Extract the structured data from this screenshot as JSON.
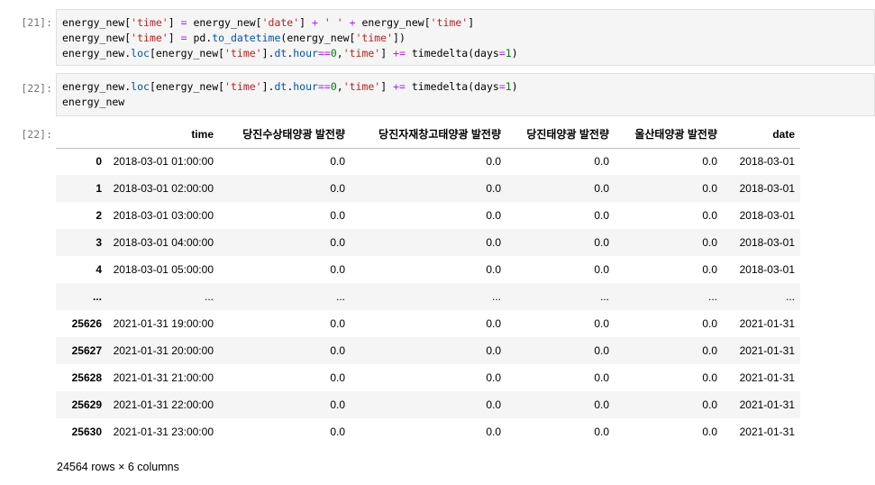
{
  "cells": [
    {
      "prompt": "[21]:",
      "lines": [
        [
          [
            "var",
            "energy_new["
          ],
          [
            "str",
            "'time'"
          ],
          [
            "var",
            "] "
          ],
          [
            "op",
            "="
          ],
          [
            "var",
            " energy_new["
          ],
          [
            "str",
            "'date'"
          ],
          [
            "var",
            "] "
          ],
          [
            "op",
            "+"
          ],
          [
            "var",
            " "
          ],
          [
            "str",
            "' '"
          ],
          [
            "var",
            " "
          ],
          [
            "op",
            "+"
          ],
          [
            "var",
            " energy_new["
          ],
          [
            "str",
            "'time'"
          ],
          [
            "var",
            "]"
          ]
        ],
        [
          [
            "var",
            "energy_new["
          ],
          [
            "str",
            "'time'"
          ],
          [
            "var",
            "] "
          ],
          [
            "op",
            "="
          ],
          [
            "var",
            " pd."
          ],
          [
            "attr",
            "to_datetime"
          ],
          [
            "var",
            "(energy_new["
          ],
          [
            "str",
            "'time'"
          ],
          [
            "var",
            "])"
          ]
        ],
        [
          [
            "var",
            "energy_new."
          ],
          [
            "attr",
            "loc"
          ],
          [
            "var",
            "[energy_new["
          ],
          [
            "str",
            "'time'"
          ],
          [
            "var",
            "]."
          ],
          [
            "attr",
            "dt"
          ],
          [
            "var",
            "."
          ],
          [
            "attr",
            "hour"
          ],
          [
            "op",
            "=="
          ],
          [
            "num",
            "0"
          ],
          [
            "var",
            ","
          ],
          [
            "str",
            "'time'"
          ],
          [
            "var",
            "] "
          ],
          [
            "op",
            "+="
          ],
          [
            "var",
            " timedelta(days"
          ],
          [
            "op",
            "="
          ],
          [
            "num",
            "1"
          ],
          [
            "var",
            ")"
          ]
        ]
      ]
    },
    {
      "prompt": "[22]:",
      "lines": [
        [
          [
            "var",
            "energy_new."
          ],
          [
            "attr",
            "loc"
          ],
          [
            "var",
            "[energy_new["
          ],
          [
            "str",
            "'time'"
          ],
          [
            "var",
            "]."
          ],
          [
            "attr",
            "dt"
          ],
          [
            "var",
            "."
          ],
          [
            "attr",
            "hour"
          ],
          [
            "op",
            "=="
          ],
          [
            "num",
            "0"
          ],
          [
            "var",
            ","
          ],
          [
            "str",
            "'time'"
          ],
          [
            "var",
            "] "
          ],
          [
            "op",
            "+="
          ],
          [
            "var",
            " timedelta(days"
          ],
          [
            "op",
            "="
          ],
          [
            "num",
            "1"
          ],
          [
            "var",
            ")"
          ]
        ],
        [
          [
            "var",
            "energy_new"
          ]
        ]
      ]
    }
  ],
  "output": {
    "prompt": "[22]:",
    "columns": [
      "",
      "time",
      "당진수상태양광 발전량",
      "당진자재창고태양광 발전량",
      "당진태양광 발전량",
      "울산태양광 발전량",
      "date"
    ],
    "rows": [
      [
        "0",
        "2018-03-01 01:00:00",
        "0.0",
        "0.0",
        "0.0",
        "0.0",
        "2018-03-01"
      ],
      [
        "1",
        "2018-03-01 02:00:00",
        "0.0",
        "0.0",
        "0.0",
        "0.0",
        "2018-03-01"
      ],
      [
        "2",
        "2018-03-01 03:00:00",
        "0.0",
        "0.0",
        "0.0",
        "0.0",
        "2018-03-01"
      ],
      [
        "3",
        "2018-03-01 04:00:00",
        "0.0",
        "0.0",
        "0.0",
        "0.0",
        "2018-03-01"
      ],
      [
        "4",
        "2018-03-01 05:00:00",
        "0.0",
        "0.0",
        "0.0",
        "0.0",
        "2018-03-01"
      ],
      [
        "...",
        "...",
        "...",
        "...",
        "...",
        "...",
        "..."
      ],
      [
        "25626",
        "2021-01-31 19:00:00",
        "0.0",
        "0.0",
        "0.0",
        "0.0",
        "2021-01-31"
      ],
      [
        "25627",
        "2021-01-31 20:00:00",
        "0.0",
        "0.0",
        "0.0",
        "0.0",
        "2021-01-31"
      ],
      [
        "25628",
        "2021-01-31 21:00:00",
        "0.0",
        "0.0",
        "0.0",
        "0.0",
        "2021-01-31"
      ],
      [
        "25629",
        "2021-01-31 22:00:00",
        "0.0",
        "0.0",
        "0.0",
        "0.0",
        "2021-01-31"
      ],
      [
        "25630",
        "2021-01-31 23:00:00",
        "0.0",
        "0.0",
        "0.0",
        "0.0",
        "2021-01-31"
      ]
    ],
    "footer": "24564 rows × 6 columns"
  }
}
